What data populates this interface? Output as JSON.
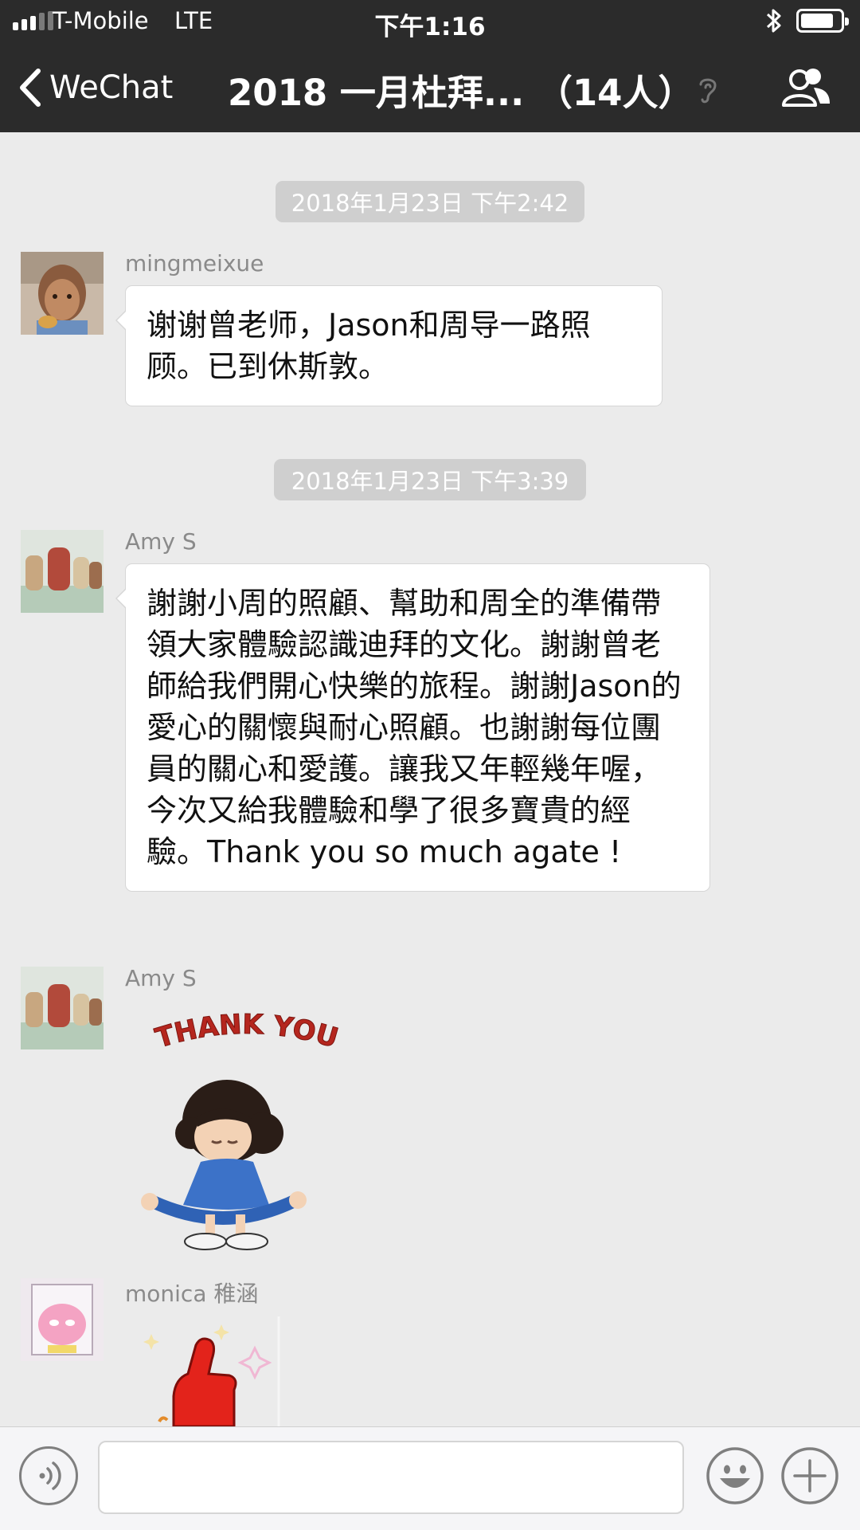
{
  "status_bar": {
    "carrier": "T-Mobile",
    "network": "LTE",
    "time": "下午1:16"
  },
  "nav": {
    "back_label": "WeChat",
    "title": "2018 一月杜拜... （14人）"
  },
  "messages": [
    {
      "timestamp": "2018年1月23日 下午2:42"
    },
    {
      "sender": "mingmeixue",
      "text": "谢谢曾老师，Jason和周导一路照顾。已到休斯敦。"
    },
    {
      "timestamp": "2018年1月23日 下午3:39"
    },
    {
      "sender": "Amy S",
      "text": "謝謝小周的照顧、幫助和周全的準備帶領大家體驗認識迪拜的文化。謝謝曾老師給我們開心快樂的旅程。謝謝Jason的愛心的關懷與耐心照顧。也謝謝每位團員的關心和愛護。讓我又年輕幾年喔，今次又給我體驗和學了很多寶貴的經驗。Thank you so much agate !"
    },
    {
      "sender": "Amy S",
      "sticker": {
        "caption": "THANK YOU",
        "icon": "girl-curtsy-sticker"
      }
    },
    {
      "sender": "monica 稚涵",
      "sticker": {
        "icon": "thumbs-up-sticker"
      }
    }
  ],
  "input_bar": {
    "voice_icon": "voice-icon",
    "emoji_icon": "emoji-icon",
    "plus_icon": "plus-icon"
  },
  "colors": {
    "nav_bg": "#2b2b2b",
    "chat_bg": "#ebebeb",
    "timestamp_bg": "#cfcfcf",
    "bubble_bg": "#ffffff"
  }
}
